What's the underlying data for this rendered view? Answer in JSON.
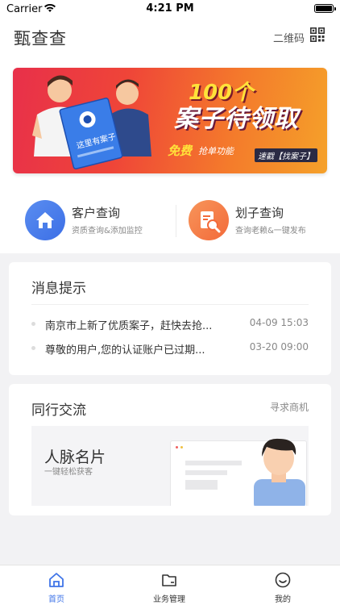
{
  "status_bar": {
    "carrier": "Carrier",
    "time": "4:21 PM"
  },
  "header": {
    "app_title": "甄查查",
    "qr_label": "二维码"
  },
  "banner": {
    "count_text": "100个",
    "main_text": "案子待领取",
    "badge_text": "这里有案子",
    "free_text": "免费",
    "feature_text": "抢单功能",
    "cta_text": "速戳【找案子】"
  },
  "quick_actions": [
    {
      "title": "客户查询",
      "subtitle": "资质查询&添加监控",
      "icon": "house-icon"
    },
    {
      "title": "划子查询",
      "subtitle": "查询老赖&一键发布",
      "icon": "document-search-icon"
    }
  ],
  "messages": {
    "title": "消息提示",
    "items": [
      {
        "text": "南京市上新了优质案子，赶快去抢...",
        "time": "04-09 15:03"
      },
      {
        "text": "尊敬的用户,您的认证账户已过期...",
        "time": "03-20 09:00"
      }
    ]
  },
  "peers": {
    "title": "同行交流",
    "more_label": "寻求商机",
    "card_title": "人脉名片",
    "card_subtitle": "一键轻松获客"
  },
  "tabbar": {
    "tabs": [
      {
        "label": "首页",
        "icon": "home-icon",
        "active": true
      },
      {
        "label": "业务管理",
        "icon": "folder-icon",
        "active": false
      },
      {
        "label": "我的",
        "icon": "smile-icon",
        "active": false
      }
    ]
  },
  "colors": {
    "accent_blue": "#3f74e8",
    "accent_orange": "#f36a3a",
    "banner_red": "#e8304a",
    "banner_yellow": "#ffe23a"
  }
}
